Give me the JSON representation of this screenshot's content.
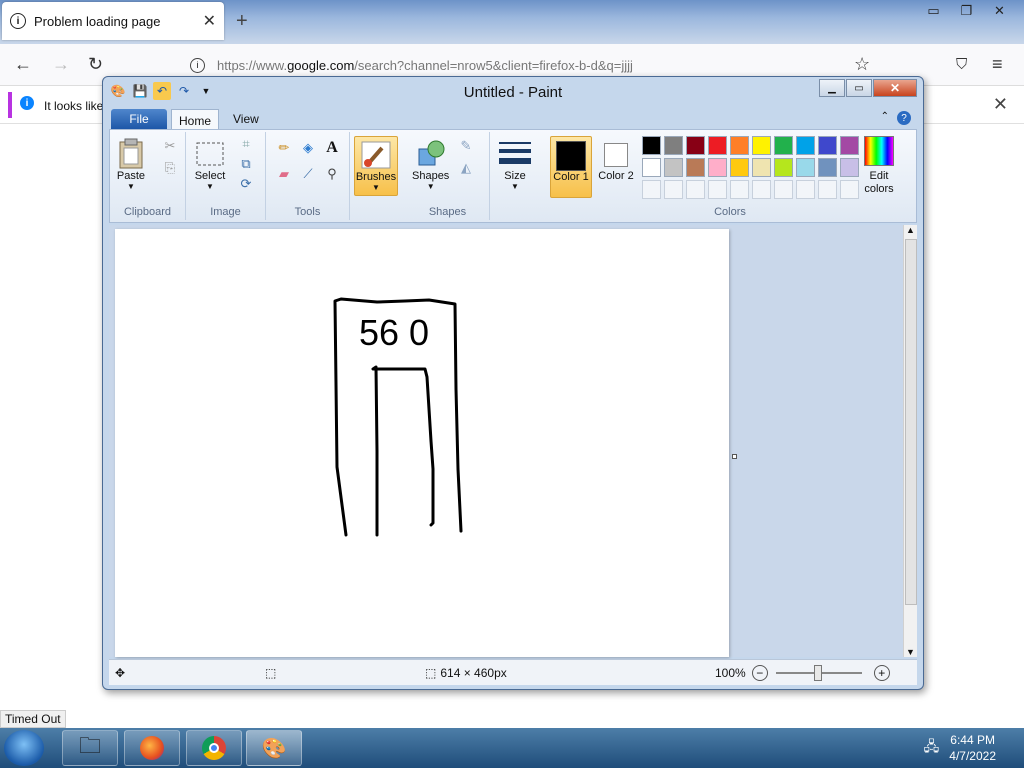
{
  "firefox": {
    "tab_title": "Problem loading page",
    "url_host_prefix": "https://www.",
    "url_host": "google.com",
    "url_rest": "/search?channel=nrow5&client=firefox-b-d&q=jjjj",
    "notification_text": "It looks like"
  },
  "status_popup": "Timed Out",
  "paint": {
    "title": "Untitled - Paint",
    "tabs": {
      "file": "File",
      "home": "Home",
      "view": "View"
    },
    "groups": {
      "clipboard": "Clipboard",
      "image": "Image",
      "tools": "Tools",
      "shapes": "Shapes",
      "colors": "Colors"
    },
    "buttons": {
      "paste": "Paste",
      "select": "Select",
      "brushes": "Brushes",
      "shapes": "Shapes",
      "size": "Size",
      "color1": "Color 1",
      "color2": "Color 2",
      "edit_colors": "Edit colors"
    },
    "palette_row1": [
      "#000000",
      "#7f7f7f",
      "#880015",
      "#ed1c24",
      "#ff7f27",
      "#fff200",
      "#22b14c",
      "#00a2e8",
      "#3f48cc",
      "#a349a4"
    ],
    "palette_row2": [
      "#ffffff",
      "#c3c3c3",
      "#b97a57",
      "#ffaec9",
      "#ffc90e",
      "#efe4b0",
      "#b5e61d",
      "#99d9ea",
      "#7092be",
      "#c8bfe7"
    ],
    "color1_value": "#000000",
    "color2_value": "#ffffff",
    "drawing_text": "56 0",
    "status": {
      "dimensions": "614 × 460px",
      "zoom": "100%"
    }
  },
  "clock": {
    "time": "6:44 PM",
    "date": "4/7/2022"
  }
}
